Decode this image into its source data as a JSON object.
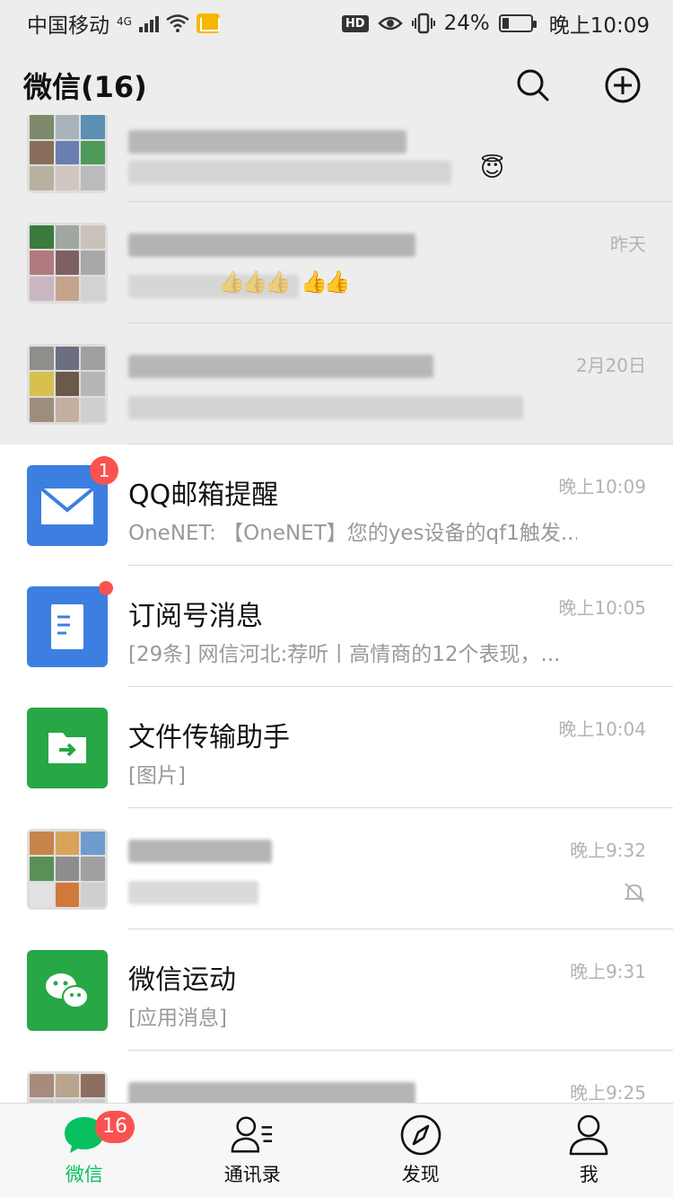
{
  "status_bar": {
    "carrier": "中国移动",
    "network": "4G",
    "battery_percent": "24%",
    "battery_level": 0.24,
    "time": "晚上10:09",
    "hd": "HD"
  },
  "header": {
    "title": "微信(16)"
  },
  "chats": [
    {
      "name": "",
      "preview": "",
      "time": "",
      "pinned": true,
      "partial": true
    },
    {
      "name": "",
      "preview": "",
      "time": "昨天",
      "pinned": true
    },
    {
      "name": "",
      "preview": "",
      "time": "2月20日",
      "pinned": true
    },
    {
      "name": "QQ邮箱提醒",
      "preview": "OneNET: 【OneNET】您的yes设备的qf1触发...",
      "time": "晚上10:09",
      "unread": "1",
      "avatar_color": "#3d7fe0"
    },
    {
      "name": "订阅号消息",
      "preview": "[29条] 网信河北:荐听丨高情商的12个表现，...",
      "time": "晚上10:05",
      "avatar_color": "#3d7fe0"
    },
    {
      "name": "文件传输助手",
      "preview": "[图片]",
      "time": "晚上10:04",
      "avatar_color": "#27a745"
    },
    {
      "name": "",
      "preview": "",
      "time": "晚上9:32",
      "muted": true
    },
    {
      "name": "微信运动",
      "preview": "[应用消息]",
      "time": "晚上9:31",
      "avatar_color": "#27a745"
    },
    {
      "name": "",
      "preview": "",
      "time": "晚上9:25"
    }
  ],
  "tabs": [
    {
      "label": "微信",
      "badge": "16",
      "icon": "chat-icon",
      "active": true
    },
    {
      "label": "通讯录",
      "icon": "contacts-icon"
    },
    {
      "label": "发现",
      "icon": "compass-icon"
    },
    {
      "label": "我",
      "icon": "person-icon"
    }
  ],
  "colors": {
    "accent": "#07c160",
    "badge": "#fa5151",
    "background": "#ededed"
  }
}
